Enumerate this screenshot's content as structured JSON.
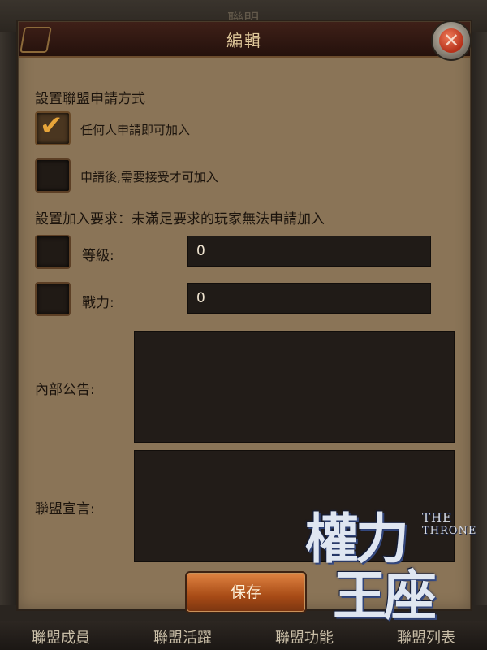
{
  "background": {
    "title": "聯盟"
  },
  "dialog": {
    "title": "編輯",
    "close_icon": "close-x-icon",
    "join_method": {
      "heading": "設置聯盟申請方式",
      "option_anyone": {
        "label": "任何人申請即可加入",
        "checked": true
      },
      "option_approval": {
        "label": "申請後,需要接受才可加入",
        "checked": false
      }
    },
    "requirements": {
      "heading": "設置加入要求：未滿足要求的玩家無法申請加入",
      "level": {
        "label": "等級:",
        "value": "0",
        "checked": false
      },
      "power": {
        "label": "戰力:",
        "value": "0",
        "checked": false
      }
    },
    "internal_notice": {
      "label": "內部公告:",
      "value": ""
    },
    "declaration": {
      "label": "聯盟宣言:",
      "value": ""
    },
    "save_label": "保存"
  },
  "tabs": [
    "聯盟成員",
    "聯盟活躍",
    "聯盟功能",
    "聯盟列表"
  ],
  "logo": {
    "big_top": "權力",
    "big_bottom": "王座",
    "the": "THE",
    "throne": "THRONE"
  },
  "colors": {
    "accent": "#e7a53a",
    "panel": "#8a7457",
    "button": "#c0601f"
  }
}
